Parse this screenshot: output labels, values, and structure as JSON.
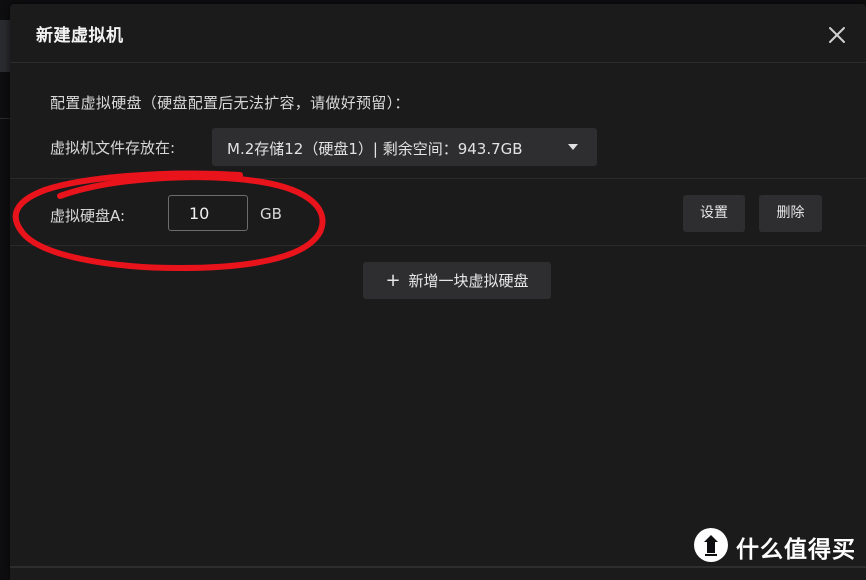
{
  "dialog": {
    "title": "新建虚拟机",
    "close_icon": "close-icon"
  },
  "disk_config": {
    "section_label": "配置虚拟硬盘（硬盘配置后无法扩容，请做好预留）：",
    "storage_label": "虚拟机文件存放在:",
    "storage_selected": "M.2存储12（硬盘1）| 剩余空间：943.7GB"
  },
  "disk_a": {
    "label": "虚拟硬盘A:",
    "size_value": "10",
    "unit": "GB",
    "settings_label": "设置",
    "delete_label": "删除"
  },
  "add_disk": {
    "label": "新增一块虚拟硬盘",
    "icon": "plus-icon"
  },
  "watermark": {
    "text": "什么值得买"
  },
  "colors": {
    "dialog_bg": "#1b1b1c",
    "button_bg": "#2e2e30",
    "annotation_red": "#e8131b"
  }
}
